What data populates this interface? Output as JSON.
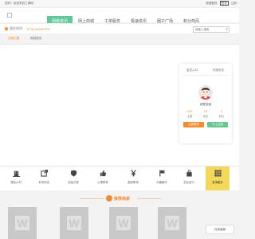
{
  "topbar": {
    "welcome": "您好！欢迎来到兰博网",
    "links": [
      "快捷登陆",
      "登录",
      "注册"
    ]
  },
  "nav": {
    "items": [
      {
        "label": "网络资讯",
        "active": true
      },
      {
        "label": "网上商城",
        "active": false
      },
      {
        "label": "工单服务",
        "active": false
      },
      {
        "label": "极速资讯",
        "active": false
      },
      {
        "label": "圈子广场",
        "active": false
      },
      {
        "label": "积分商风",
        "active": false
      }
    ]
  },
  "location": {
    "label": "服务热线",
    "phone": "0731-82340733"
  },
  "search": {
    "placeholder": "请输入搜索",
    "icon": "search-icon"
  },
  "breadcrumb": {
    "home": "当前位置",
    "current": "网站首页"
  },
  "user_card": {
    "tabs": [
      "会员入口",
      "快捷登录"
    ],
    "name": "我是游客",
    "stats": [
      {
        "value": "423",
        "label": "主题"
      },
      {
        "value": "12",
        "label": "回应"
      },
      {
        "value": "2",
        "label": "粉丝"
      }
    ],
    "buttons": [
      "立即登录",
      "马上注册"
    ]
  },
  "tiles": [
    {
      "label": "便民乡村",
      "icon": "building-icon"
    },
    {
      "label": "本来科技",
      "icon": "external-link-icon"
    },
    {
      "label": "包装方案",
      "icon": "shield-icon"
    },
    {
      "label": "心理故事",
      "icon": "thumbs-icon"
    },
    {
      "label": "图说职场",
      "icon": "yen-icon"
    },
    {
      "label": "乐趣魔坊",
      "icon": "flag-icon"
    },
    {
      "label": "农业技行",
      "icon": "bag-icon"
    },
    {
      "label": "查询更多",
      "icon": "grid-icon",
      "active": true
    }
  ],
  "recommend": {
    "title": "推荐商家"
  },
  "float": {
    "label": "在线客服"
  },
  "colors": {
    "accent_green": "#60c79c",
    "accent_orange": "#f28c2f",
    "tile_active": "#f4d85a"
  }
}
